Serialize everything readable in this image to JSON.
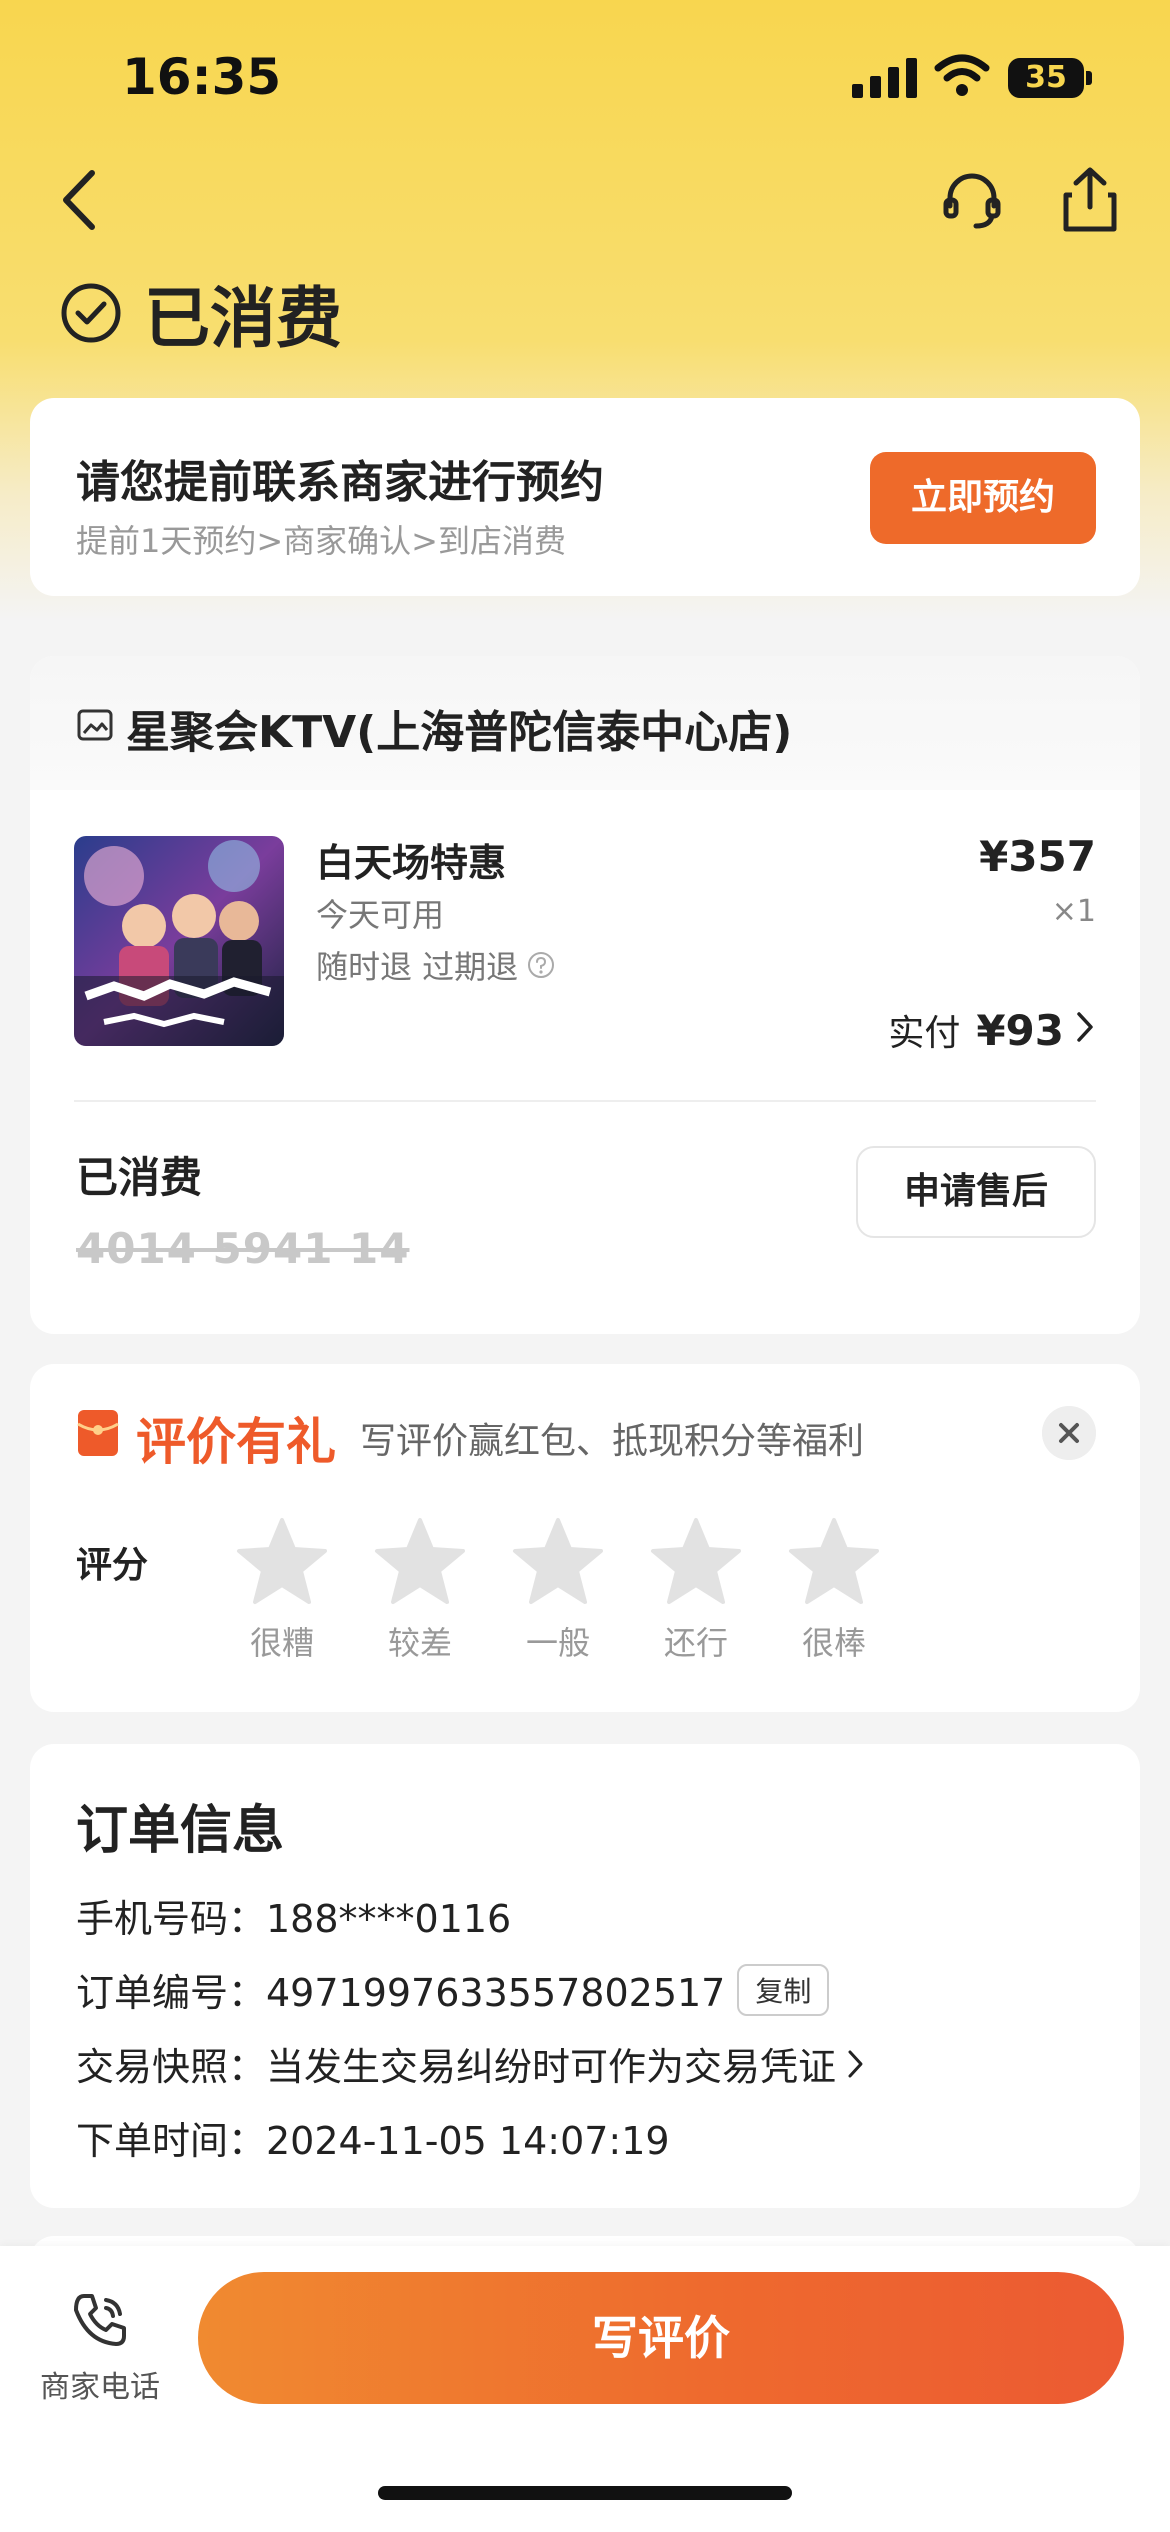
{
  "status_bar": {
    "time": "16:35",
    "battery": "35"
  },
  "header": {
    "status_title": "已消费"
  },
  "reserve": {
    "title": "请您提前联系商家进行预约",
    "subtitle": "提前1天预约>商家确认>到店消费",
    "button": "立即预约"
  },
  "order": {
    "shop_name": "星聚会KTV(上海普陀信泰中心店)",
    "product_name": "白天场特惠",
    "availability": "今天可用",
    "refund_policy": "随时退 过期退",
    "price": "¥357",
    "quantity": "×1",
    "paid_label": "实付",
    "paid_amount": "¥93",
    "consumed_label": "已消费",
    "voucher_code": "4014 5941 14",
    "aftersale_button": "申请售后"
  },
  "review": {
    "title": "评价有礼",
    "description": "写评价赢红包、抵现积分等福利",
    "rating_label": "评分",
    "stars": [
      {
        "label": "很糟"
      },
      {
        "label": "较差"
      },
      {
        "label": "一般"
      },
      {
        "label": "还行"
      },
      {
        "label": "很棒"
      }
    ]
  },
  "order_info": {
    "title": "订单信息",
    "phone": "手机号码：188****0116",
    "order_no": "订单编号：4971997633557802517",
    "copy": "复制",
    "snapshot": "交易快照：当发生交易纠纷时可作为交易凭证",
    "order_time": "下单时间：2024-11-05 14:07:19"
  },
  "bottom": {
    "merchant_phone": "商家电话",
    "write_review": "写评价"
  },
  "colors": {
    "accent_orange": "#ee6a2a",
    "header_yellow": "#f8d64f"
  }
}
